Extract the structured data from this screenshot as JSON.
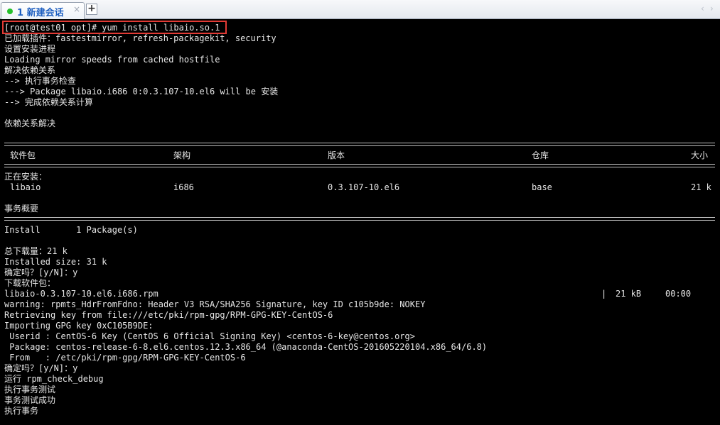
{
  "tab": {
    "title": "1 新建会话",
    "close_glyph": "×",
    "new_glyph": "+",
    "nav_prev_glyph": "‹",
    "nav_next_glyph": "›",
    "status_color": "#25c02c"
  },
  "terminal": {
    "command_line": "[root@test01 opt]# yum install libaio.so.1",
    "pre_lines": [
      "已加载插件：fastestmirror, refresh-packagekit, security",
      "设置安装进程",
      "Loading mirror speeds from cached hostfile",
      "解决依赖关系",
      "--> 执行事务检查",
      "---> Package libaio.i686 0:0.3.107-10.el6 will be 安装",
      "--> 完成依赖关系计算",
      "",
      "依赖关系解决"
    ],
    "table": {
      "headers": [
        "软件包",
        "架构",
        "版本",
        "仓库",
        "大小"
      ],
      "section_label": "正在安装：",
      "rows": [
        [
          "libaio",
          "i686",
          "0.3.107-10.el6",
          "base",
          "21 k"
        ]
      ]
    },
    "summary_label": "事务概要",
    "install_summary": "Install       1 Package(s)",
    "post_lines": [
      "总下载量：21 k",
      "Installed size: 31 k",
      "确定吗？[y/N]：y",
      "下载软件包："
    ],
    "download": {
      "filename": "libaio-0.3.107-10.el6.i686.rpm",
      "separator": "|",
      "size": "21 kB",
      "time": "00:00"
    },
    "tail_lines": [
      "warning: rpmts_HdrFromFdno: Header V3 RSA/SHA256 Signature, key ID c105b9de: NOKEY",
      "Retrieving key from file:///etc/pki/rpm-gpg/RPM-GPG-KEY-CentOS-6",
      "Importing GPG key 0xC105B9DE:",
      " Userid : CentOS-6 Key (CentOS 6 Official Signing Key) <centos-6-key@centos.org>",
      " Package: centos-release-6-8.el6.centos.12.3.x86_64 (@anaconda-CentOS-201605220104.x86_64/6.8)",
      " From   : /etc/pki/rpm-gpg/RPM-GPG-KEY-CentOS-6",
      "确定吗？[y/N]：y",
      "运行 rpm_check_debug",
      "执行事务测试",
      "事务测试成功",
      "执行事务"
    ],
    "highlight_color": "#e23b35"
  }
}
